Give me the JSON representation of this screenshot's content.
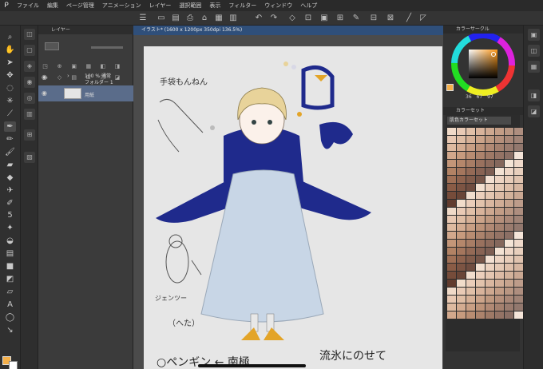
{
  "menu": {
    "items": [
      "ファイル",
      "編集",
      "ページ管理",
      "アニメーション",
      "レイヤー",
      "選択範囲",
      "表示",
      "フィルター",
      "ウィンドウ",
      "ヘルプ"
    ]
  },
  "layer_panel": {
    "tab_label": "レイヤー",
    "layers": [
      {
        "line1": "100 % 通常",
        "line2": "フォルダー 1"
      },
      {
        "line1": "",
        "line2": "用紙"
      }
    ]
  },
  "document": {
    "tab_label": "イラスト* (1600 x 1200px 350dpi 136.5%)"
  },
  "color_panel": {
    "tab_label": "カラーサークル",
    "values": [
      "36",
      "67",
      "97"
    ],
    "main_color": "#f5b04a",
    "sub_color": "#ffffff"
  },
  "palette_panel": {
    "tab_label": "カラーセット",
    "set_name": "肌色カラーセット"
  },
  "canvas_text": {
    "note_top": "手袋もんねん",
    "note_jentoo": "ジェンツー",
    "note_heta": "（へた）",
    "note_bottom_left": "○ペンギン ← 南極",
    "note_bottom_right": "流氷にのせて"
  },
  "colors": {
    "accent": "#2f4f7a",
    "selected_layer": "#5a6c8a",
    "penguin_blue": "#1f2a8c",
    "body_light": "#c8d6e6",
    "hair": "#e8d39a"
  }
}
